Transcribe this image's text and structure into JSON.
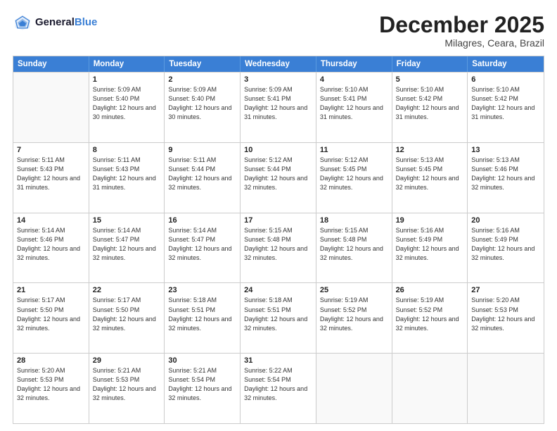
{
  "header": {
    "logo_line1": "General",
    "logo_line2": "Blue",
    "month": "December 2025",
    "location": "Milagres, Ceara, Brazil"
  },
  "days_of_week": [
    "Sunday",
    "Monday",
    "Tuesday",
    "Wednesday",
    "Thursday",
    "Friday",
    "Saturday"
  ],
  "rows": [
    [
      {
        "day": "",
        "sunrise": "",
        "sunset": "",
        "daylight": "",
        "empty": true
      },
      {
        "day": "1",
        "sunrise": "Sunrise: 5:09 AM",
        "sunset": "Sunset: 5:40 PM",
        "daylight": "Daylight: 12 hours and 30 minutes."
      },
      {
        "day": "2",
        "sunrise": "Sunrise: 5:09 AM",
        "sunset": "Sunset: 5:40 PM",
        "daylight": "Daylight: 12 hours and 30 minutes."
      },
      {
        "day": "3",
        "sunrise": "Sunrise: 5:09 AM",
        "sunset": "Sunset: 5:41 PM",
        "daylight": "Daylight: 12 hours and 31 minutes."
      },
      {
        "day": "4",
        "sunrise": "Sunrise: 5:10 AM",
        "sunset": "Sunset: 5:41 PM",
        "daylight": "Daylight: 12 hours and 31 minutes."
      },
      {
        "day": "5",
        "sunrise": "Sunrise: 5:10 AM",
        "sunset": "Sunset: 5:42 PM",
        "daylight": "Daylight: 12 hours and 31 minutes."
      },
      {
        "day": "6",
        "sunrise": "Sunrise: 5:10 AM",
        "sunset": "Sunset: 5:42 PM",
        "daylight": "Daylight: 12 hours and 31 minutes."
      }
    ],
    [
      {
        "day": "7",
        "sunrise": "Sunrise: 5:11 AM",
        "sunset": "Sunset: 5:43 PM",
        "daylight": "Daylight: 12 hours and 31 minutes."
      },
      {
        "day": "8",
        "sunrise": "Sunrise: 5:11 AM",
        "sunset": "Sunset: 5:43 PM",
        "daylight": "Daylight: 12 hours and 31 minutes."
      },
      {
        "day": "9",
        "sunrise": "Sunrise: 5:11 AM",
        "sunset": "Sunset: 5:44 PM",
        "daylight": "Daylight: 12 hours and 32 minutes."
      },
      {
        "day": "10",
        "sunrise": "Sunrise: 5:12 AM",
        "sunset": "Sunset: 5:44 PM",
        "daylight": "Daylight: 12 hours and 32 minutes."
      },
      {
        "day": "11",
        "sunrise": "Sunrise: 5:12 AM",
        "sunset": "Sunset: 5:45 PM",
        "daylight": "Daylight: 12 hours and 32 minutes."
      },
      {
        "day": "12",
        "sunrise": "Sunrise: 5:13 AM",
        "sunset": "Sunset: 5:45 PM",
        "daylight": "Daylight: 12 hours and 32 minutes."
      },
      {
        "day": "13",
        "sunrise": "Sunrise: 5:13 AM",
        "sunset": "Sunset: 5:46 PM",
        "daylight": "Daylight: 12 hours and 32 minutes."
      }
    ],
    [
      {
        "day": "14",
        "sunrise": "Sunrise: 5:14 AM",
        "sunset": "Sunset: 5:46 PM",
        "daylight": "Daylight: 12 hours and 32 minutes."
      },
      {
        "day": "15",
        "sunrise": "Sunrise: 5:14 AM",
        "sunset": "Sunset: 5:47 PM",
        "daylight": "Daylight: 12 hours and 32 minutes."
      },
      {
        "day": "16",
        "sunrise": "Sunrise: 5:14 AM",
        "sunset": "Sunset: 5:47 PM",
        "daylight": "Daylight: 12 hours and 32 minutes."
      },
      {
        "day": "17",
        "sunrise": "Sunrise: 5:15 AM",
        "sunset": "Sunset: 5:48 PM",
        "daylight": "Daylight: 12 hours and 32 minutes."
      },
      {
        "day": "18",
        "sunrise": "Sunrise: 5:15 AM",
        "sunset": "Sunset: 5:48 PM",
        "daylight": "Daylight: 12 hours and 32 minutes."
      },
      {
        "day": "19",
        "sunrise": "Sunrise: 5:16 AM",
        "sunset": "Sunset: 5:49 PM",
        "daylight": "Daylight: 12 hours and 32 minutes."
      },
      {
        "day": "20",
        "sunrise": "Sunrise: 5:16 AM",
        "sunset": "Sunset: 5:49 PM",
        "daylight": "Daylight: 12 hours and 32 minutes."
      }
    ],
    [
      {
        "day": "21",
        "sunrise": "Sunrise: 5:17 AM",
        "sunset": "Sunset: 5:50 PM",
        "daylight": "Daylight: 12 hours and 32 minutes."
      },
      {
        "day": "22",
        "sunrise": "Sunrise: 5:17 AM",
        "sunset": "Sunset: 5:50 PM",
        "daylight": "Daylight: 12 hours and 32 minutes."
      },
      {
        "day": "23",
        "sunrise": "Sunrise: 5:18 AM",
        "sunset": "Sunset: 5:51 PM",
        "daylight": "Daylight: 12 hours and 32 minutes."
      },
      {
        "day": "24",
        "sunrise": "Sunrise: 5:18 AM",
        "sunset": "Sunset: 5:51 PM",
        "daylight": "Daylight: 12 hours and 32 minutes."
      },
      {
        "day": "25",
        "sunrise": "Sunrise: 5:19 AM",
        "sunset": "Sunset: 5:52 PM",
        "daylight": "Daylight: 12 hours and 32 minutes."
      },
      {
        "day": "26",
        "sunrise": "Sunrise: 5:19 AM",
        "sunset": "Sunset: 5:52 PM",
        "daylight": "Daylight: 12 hours and 32 minutes."
      },
      {
        "day": "27",
        "sunrise": "Sunrise: 5:20 AM",
        "sunset": "Sunset: 5:53 PM",
        "daylight": "Daylight: 12 hours and 32 minutes."
      }
    ],
    [
      {
        "day": "28",
        "sunrise": "Sunrise: 5:20 AM",
        "sunset": "Sunset: 5:53 PM",
        "daylight": "Daylight: 12 hours and 32 minutes."
      },
      {
        "day": "29",
        "sunrise": "Sunrise: 5:21 AM",
        "sunset": "Sunset: 5:53 PM",
        "daylight": "Daylight: 12 hours and 32 minutes."
      },
      {
        "day": "30",
        "sunrise": "Sunrise: 5:21 AM",
        "sunset": "Sunset: 5:54 PM",
        "daylight": "Daylight: 12 hours and 32 minutes."
      },
      {
        "day": "31",
        "sunrise": "Sunrise: 5:22 AM",
        "sunset": "Sunset: 5:54 PM",
        "daylight": "Daylight: 12 hours and 32 minutes."
      },
      {
        "day": "",
        "sunrise": "",
        "sunset": "",
        "daylight": "",
        "empty": true
      },
      {
        "day": "",
        "sunrise": "",
        "sunset": "",
        "daylight": "",
        "empty": true
      },
      {
        "day": "",
        "sunrise": "",
        "sunset": "",
        "daylight": "",
        "empty": true
      }
    ]
  ]
}
